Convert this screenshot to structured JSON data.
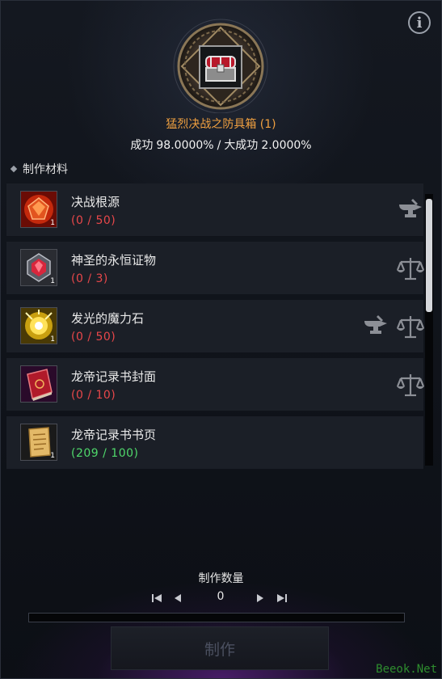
{
  "header": {
    "item_name": "猛烈决战之防具箱 (1)",
    "success_label": "成功",
    "success_rate": "98.0000%",
    "separator": "/",
    "great_success_label": "大成功",
    "great_success_rate": "2.0000%"
  },
  "materials": {
    "title": "制作材料",
    "items": [
      {
        "name": "决战根源",
        "qty": "(0 / 50)",
        "status": "insufficient",
        "icon": "red-crystal-icon",
        "count": "1",
        "actions": [
          "anvil-icon"
        ]
      },
      {
        "name": "神圣的永恒证物",
        "qty": "(0 / 3)",
        "status": "insufficient",
        "icon": "ruby-gem-icon",
        "count": "1",
        "actions": [
          "scale-icon"
        ]
      },
      {
        "name": "发光的魔力石",
        "qty": "(0 / 50)",
        "status": "insufficient",
        "icon": "glowing-stone-icon",
        "count": "1",
        "actions": [
          "anvil-icon",
          "scale-icon"
        ]
      },
      {
        "name": "龙帝记录书封面",
        "qty": "(0 / 10)",
        "status": "insufficient",
        "icon": "red-book-icon",
        "count": "",
        "actions": [
          "scale-icon"
        ]
      },
      {
        "name": "龙帝记录书书页",
        "qty": "(209 / 100)",
        "status": "sufficient",
        "icon": "scroll-page-icon",
        "count": "1",
        "actions": []
      }
    ]
  },
  "craft": {
    "quantity_label": "制作数量",
    "quantity_value": "0",
    "progress_fraction": 0,
    "button_label": "制作"
  },
  "info_icon": "ⓘ",
  "watermark": "Beeok.Net",
  "colors": {
    "item_name": "#f0a040",
    "insufficient": "#e8474a",
    "sufficient": "#4fd86b",
    "progress": "#c79a35"
  }
}
